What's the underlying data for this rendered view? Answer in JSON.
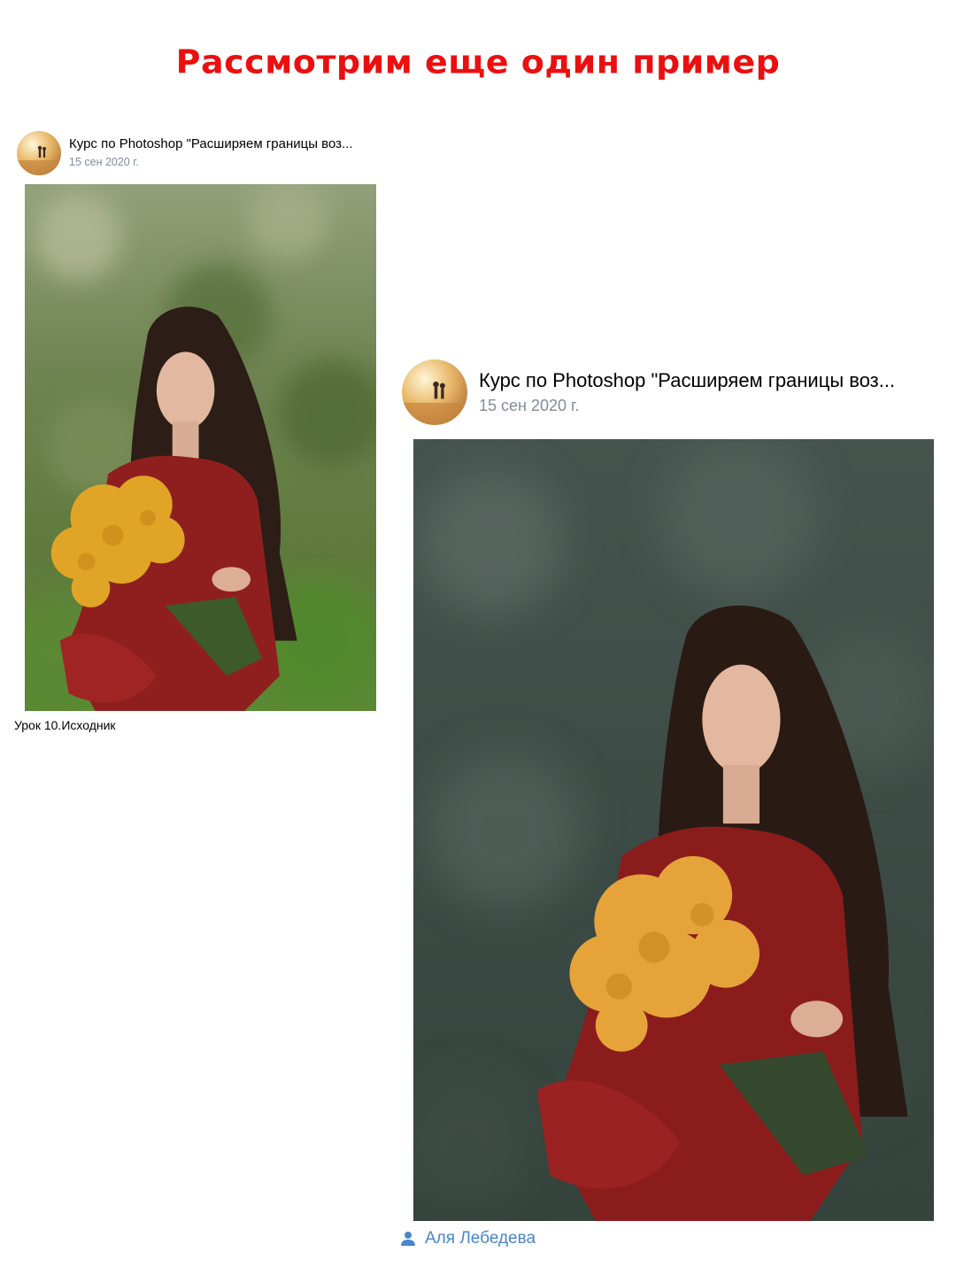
{
  "headline": "Рассмотрим еще один пример",
  "posts": [
    {
      "title": "Курс по Photoshop \"Расширяем границы воз...",
      "date": "15 сен 2020 г.",
      "avatar_icon": "community-avatar",
      "photo_kind": "original",
      "caption": "Урок 10.Исходник"
    },
    {
      "title": "Курс по Photoshop \"Расширяем границы воз...",
      "date": "15 сен 2020 г.",
      "avatar_icon": "community-avatar",
      "photo_kind": "edited",
      "author": "Аля Лебедева",
      "author_icon": "person-icon"
    }
  ],
  "colors": {
    "headline": "#ec0f0f",
    "date": "#818c99",
    "author_link": "#4a86c8"
  }
}
